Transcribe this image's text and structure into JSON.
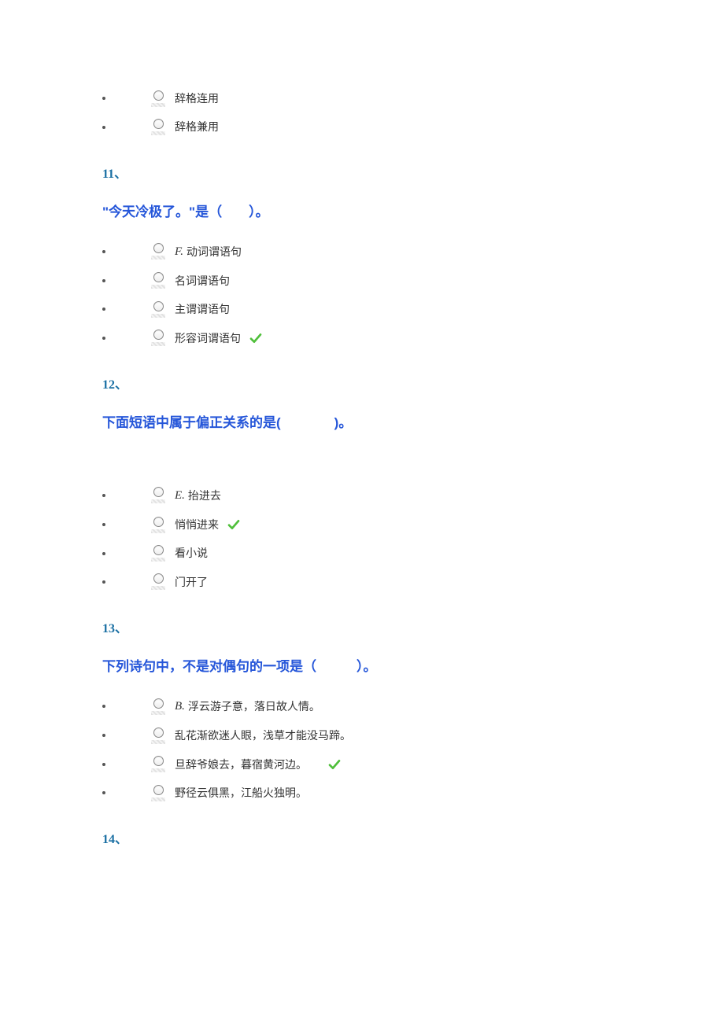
{
  "orphan_options": [
    {
      "text": "辞格连用",
      "correct": false
    },
    {
      "text": "辞格兼用",
      "correct": false
    }
  ],
  "questions": [
    {
      "number": "11、",
      "text": "\"今天冷极了。\"是（　　）。",
      "options": [
        {
          "prefix": "F.",
          "text": "动词谓语句",
          "correct": false
        },
        {
          "prefix": "",
          "text": "名词谓语句",
          "correct": false
        },
        {
          "prefix": "",
          "text": "主谓谓语句",
          "correct": false
        },
        {
          "prefix": "",
          "text": "形容词谓语句",
          "correct": true
        }
      ]
    },
    {
      "number": "12、",
      "text": "下面短语中属于偏正关系的是(　　　　)。",
      "extra_space": true,
      "options": [
        {
          "prefix": "E.",
          "text": "抬进去",
          "correct": false
        },
        {
          "prefix": "",
          "text": "悄悄进来",
          "correct": true
        },
        {
          "prefix": "",
          "text": "看小说",
          "correct": false
        },
        {
          "prefix": "",
          "text": "门开了",
          "correct": false
        }
      ]
    },
    {
      "number": "13、",
      "text": "下列诗句中，不是对偶句的一项是（　　　）。",
      "options": [
        {
          "prefix": "B.",
          "text": "浮云游子意，落日故人情。",
          "correct": false
        },
        {
          "prefix": "",
          "text": "乱花渐欲迷人眼，浅草才能没马蹄。",
          "correct": false
        },
        {
          "prefix": "",
          "text": "旦辞爷娘去，暮宿黄河边。",
          "correct": true,
          "check_gap": true
        },
        {
          "prefix": "",
          "text": "野径云俱黑，江船火独明。",
          "correct": false
        }
      ]
    }
  ],
  "trailing_number": "14、"
}
